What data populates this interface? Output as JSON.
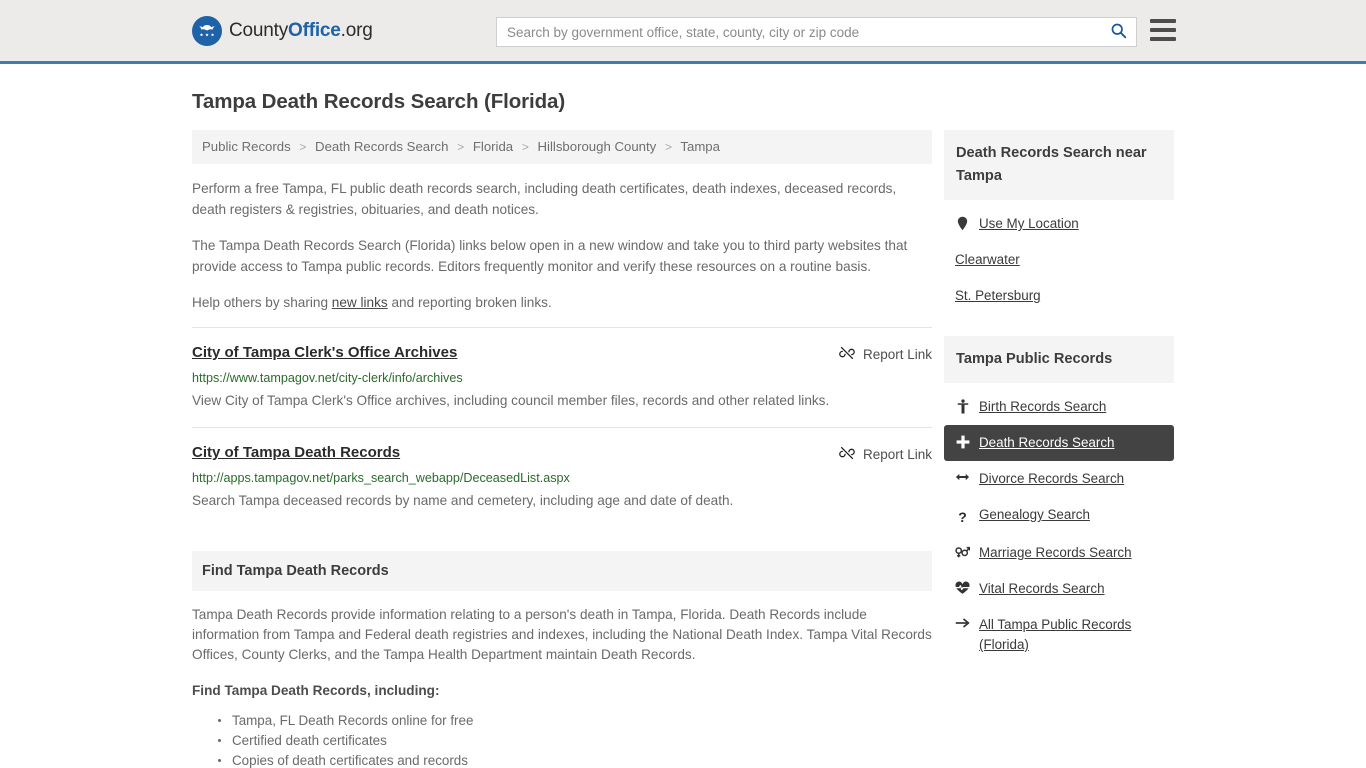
{
  "header": {
    "logo": {
      "icon": "eagle-shield-logo-icon",
      "part1": "County",
      "part2": "Office",
      "part3": ".org"
    },
    "search": {
      "placeholder": "Search by government office, state, county, city or zip code",
      "value": "",
      "button_icon": "search-icon"
    },
    "menu_icon": "hamburger-menu-icon",
    "accent_color": "#3c7cb1",
    "background_color": "#ecebe9"
  },
  "page_title": "Tampa Death Records Search (Florida)",
  "breadcrumb": {
    "separator": ">",
    "items": [
      {
        "label": "Public Records"
      },
      {
        "label": "Death Records Search"
      },
      {
        "label": "Florida"
      },
      {
        "label": "Hillsborough County"
      },
      {
        "label": "Tampa"
      }
    ]
  },
  "intro": {
    "paragraph1": "Perform a free Tampa, FL public death records search, including death certificates, death indexes, deceased records, death registers & registries, obituaries, and death notices.",
    "paragraph2": "The Tampa Death Records Search (Florida) links below open in a new window and take you to third party websites that provide access to Tampa public records. Editors frequently monitor and verify these resources on a routine basis.",
    "help_prefix": "Help others by sharing ",
    "help_link": "new links",
    "help_suffix": " and reporting broken links."
  },
  "results": {
    "report_label": "Report Link",
    "report_icon": "broken-link-icon",
    "items": [
      {
        "title": "City of Tampa Clerk's Office Archives",
        "url": "https://www.tampagov.net/city-clerk/info/archives",
        "description": "View City of Tampa Clerk's Office archives, including council member files, records and other related links."
      },
      {
        "title": "City of Tampa Death Records",
        "url": "http://apps.tampagov.net/parks_search_webapp/DeceasedList.aspx",
        "description": "Search Tampa deceased records by name and cemetery, including age and date of death."
      }
    ]
  },
  "find_section": {
    "heading": "Find Tampa Death Records",
    "paragraph": "Tampa Death Records provide information relating to a person's death in Tampa, Florida. Death Records include information from Tampa and Federal death registries and indexes, including the National Death Index. Tampa Vital Records Offices, County Clerks, and the Tampa Health Department maintain Death Records.",
    "list_heading": "Find Tampa Death Records, including:",
    "bullets": [
      "Tampa, FL Death Records online for free",
      "Certified death certificates",
      "Copies of death certificates and records"
    ]
  },
  "sidebar": {
    "near_card": {
      "heading": "Death Records Search near Tampa",
      "items": [
        {
          "label": "Use My Location",
          "icon": "map-pin-icon",
          "has_icon": true
        },
        {
          "label": "Clearwater",
          "icon": "",
          "has_icon": false
        },
        {
          "label": "St. Petersburg",
          "icon": "",
          "has_icon": false
        }
      ]
    },
    "public_records_card": {
      "heading": "Tampa Public Records",
      "active_color": "#434343",
      "items": [
        {
          "label": "Birth Records Search",
          "icon": "baby-icon",
          "active": false
        },
        {
          "label": "Death Records Search",
          "icon": "cross-plus-icon",
          "active": true
        },
        {
          "label": "Divorce Records Search",
          "icon": "left-right-arrow-icon",
          "active": false
        },
        {
          "label": "Genealogy Search",
          "icon": "question-mark-icon",
          "active": false
        },
        {
          "label": "Marriage Records Search",
          "icon": "venus-mars-icon",
          "active": false
        },
        {
          "label": "Vital Records Search",
          "icon": "heartbeat-icon",
          "active": false
        },
        {
          "label": "All Tampa Public Records (Florida)",
          "icon": "arrow-right-icon",
          "active": false
        }
      ]
    }
  }
}
